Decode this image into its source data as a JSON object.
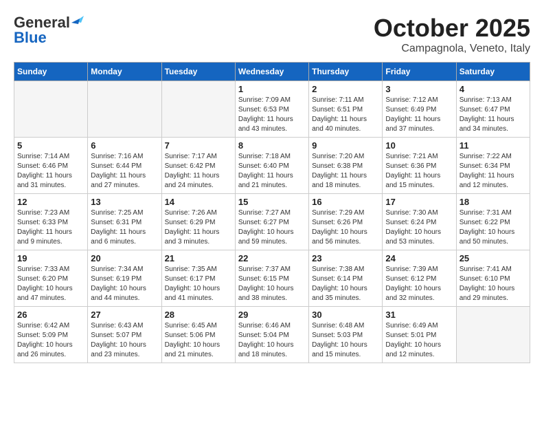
{
  "header": {
    "logo_line1": "General",
    "logo_line2": "Blue",
    "month": "October 2025",
    "location": "Campagnola, Veneto, Italy"
  },
  "days_of_week": [
    "Sunday",
    "Monday",
    "Tuesday",
    "Wednesday",
    "Thursday",
    "Friday",
    "Saturday"
  ],
  "weeks": [
    [
      {
        "day": "",
        "info": ""
      },
      {
        "day": "",
        "info": ""
      },
      {
        "day": "",
        "info": ""
      },
      {
        "day": "1",
        "info": "Sunrise: 7:09 AM\nSunset: 6:53 PM\nDaylight: 11 hours\nand 43 minutes."
      },
      {
        "day": "2",
        "info": "Sunrise: 7:11 AM\nSunset: 6:51 PM\nDaylight: 11 hours\nand 40 minutes."
      },
      {
        "day": "3",
        "info": "Sunrise: 7:12 AM\nSunset: 6:49 PM\nDaylight: 11 hours\nand 37 minutes."
      },
      {
        "day": "4",
        "info": "Sunrise: 7:13 AM\nSunset: 6:47 PM\nDaylight: 11 hours\nand 34 minutes."
      }
    ],
    [
      {
        "day": "5",
        "info": "Sunrise: 7:14 AM\nSunset: 6:46 PM\nDaylight: 11 hours\nand 31 minutes."
      },
      {
        "day": "6",
        "info": "Sunrise: 7:16 AM\nSunset: 6:44 PM\nDaylight: 11 hours\nand 27 minutes."
      },
      {
        "day": "7",
        "info": "Sunrise: 7:17 AM\nSunset: 6:42 PM\nDaylight: 11 hours\nand 24 minutes."
      },
      {
        "day": "8",
        "info": "Sunrise: 7:18 AM\nSunset: 6:40 PM\nDaylight: 11 hours\nand 21 minutes."
      },
      {
        "day": "9",
        "info": "Sunrise: 7:20 AM\nSunset: 6:38 PM\nDaylight: 11 hours\nand 18 minutes."
      },
      {
        "day": "10",
        "info": "Sunrise: 7:21 AM\nSunset: 6:36 PM\nDaylight: 11 hours\nand 15 minutes."
      },
      {
        "day": "11",
        "info": "Sunrise: 7:22 AM\nSunset: 6:34 PM\nDaylight: 11 hours\nand 12 minutes."
      }
    ],
    [
      {
        "day": "12",
        "info": "Sunrise: 7:23 AM\nSunset: 6:33 PM\nDaylight: 11 hours\nand 9 minutes."
      },
      {
        "day": "13",
        "info": "Sunrise: 7:25 AM\nSunset: 6:31 PM\nDaylight: 11 hours\nand 6 minutes."
      },
      {
        "day": "14",
        "info": "Sunrise: 7:26 AM\nSunset: 6:29 PM\nDaylight: 11 hours\nand 3 minutes."
      },
      {
        "day": "15",
        "info": "Sunrise: 7:27 AM\nSunset: 6:27 PM\nDaylight: 10 hours\nand 59 minutes."
      },
      {
        "day": "16",
        "info": "Sunrise: 7:29 AM\nSunset: 6:26 PM\nDaylight: 10 hours\nand 56 minutes."
      },
      {
        "day": "17",
        "info": "Sunrise: 7:30 AM\nSunset: 6:24 PM\nDaylight: 10 hours\nand 53 minutes."
      },
      {
        "day": "18",
        "info": "Sunrise: 7:31 AM\nSunset: 6:22 PM\nDaylight: 10 hours\nand 50 minutes."
      }
    ],
    [
      {
        "day": "19",
        "info": "Sunrise: 7:33 AM\nSunset: 6:20 PM\nDaylight: 10 hours\nand 47 minutes."
      },
      {
        "day": "20",
        "info": "Sunrise: 7:34 AM\nSunset: 6:19 PM\nDaylight: 10 hours\nand 44 minutes."
      },
      {
        "day": "21",
        "info": "Sunrise: 7:35 AM\nSunset: 6:17 PM\nDaylight: 10 hours\nand 41 minutes."
      },
      {
        "day": "22",
        "info": "Sunrise: 7:37 AM\nSunset: 6:15 PM\nDaylight: 10 hours\nand 38 minutes."
      },
      {
        "day": "23",
        "info": "Sunrise: 7:38 AM\nSunset: 6:14 PM\nDaylight: 10 hours\nand 35 minutes."
      },
      {
        "day": "24",
        "info": "Sunrise: 7:39 AM\nSunset: 6:12 PM\nDaylight: 10 hours\nand 32 minutes."
      },
      {
        "day": "25",
        "info": "Sunrise: 7:41 AM\nSunset: 6:10 PM\nDaylight: 10 hours\nand 29 minutes."
      }
    ],
    [
      {
        "day": "26",
        "info": "Sunrise: 6:42 AM\nSunset: 5:09 PM\nDaylight: 10 hours\nand 26 minutes."
      },
      {
        "day": "27",
        "info": "Sunrise: 6:43 AM\nSunset: 5:07 PM\nDaylight: 10 hours\nand 23 minutes."
      },
      {
        "day": "28",
        "info": "Sunrise: 6:45 AM\nSunset: 5:06 PM\nDaylight: 10 hours\nand 21 minutes."
      },
      {
        "day": "29",
        "info": "Sunrise: 6:46 AM\nSunset: 5:04 PM\nDaylight: 10 hours\nand 18 minutes."
      },
      {
        "day": "30",
        "info": "Sunrise: 6:48 AM\nSunset: 5:03 PM\nDaylight: 10 hours\nand 15 minutes."
      },
      {
        "day": "31",
        "info": "Sunrise: 6:49 AM\nSunset: 5:01 PM\nDaylight: 10 hours\nand 12 minutes."
      },
      {
        "day": "",
        "info": ""
      }
    ]
  ]
}
